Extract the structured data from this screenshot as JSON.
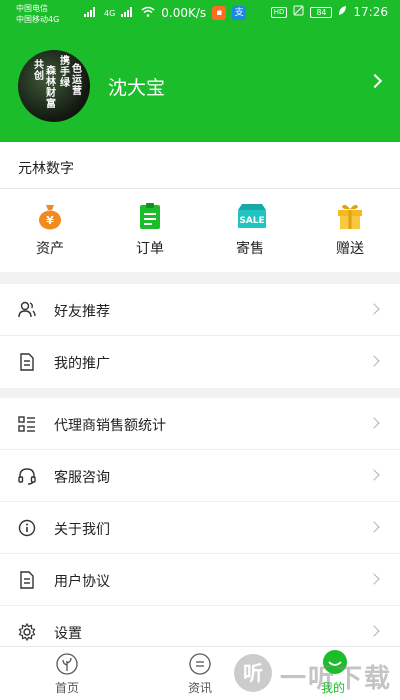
{
  "status_bar": {
    "carrier1": "中国电信",
    "carrier2": "中国移动4G",
    "network_label": "4G",
    "speed": "0.00K/s",
    "battery": "84",
    "time": "17:26",
    "hd": "HD"
  },
  "profile": {
    "name": "沈大宝",
    "avatar_text": [
      "共",
      "创",
      "森",
      "林",
      "财",
      "富",
      "携",
      "手",
      "绿",
      "色",
      "运",
      "营"
    ]
  },
  "wallet": {
    "title": "元林数字",
    "items": [
      {
        "label": "资产",
        "icon": "money-bag-icon",
        "color": "#f28a1e",
        "glyph": "¥"
      },
      {
        "label": "订单",
        "icon": "clipboard-icon",
        "color": "#1bbd2a"
      },
      {
        "label": "寄售",
        "icon": "sale-tag-icon",
        "color": "#20c5c1",
        "glyph": "SALE"
      },
      {
        "label": "赠送",
        "icon": "gift-icon",
        "color": "#f5b81e"
      }
    ]
  },
  "menu": {
    "group1": [
      {
        "label": "好友推荐",
        "icon": "people-icon"
      },
      {
        "label": "我的推广",
        "icon": "document-icon"
      }
    ],
    "group2": [
      {
        "label": "代理商销售额统计",
        "icon": "list-stats-icon"
      },
      {
        "label": "客服咨询",
        "icon": "headset-icon"
      },
      {
        "label": "关于我们",
        "icon": "info-icon"
      },
      {
        "label": "用户协议",
        "icon": "document-icon"
      },
      {
        "label": "设置",
        "icon": "gear-icon"
      }
    ]
  },
  "tabbar": {
    "tabs": [
      {
        "label": "首页",
        "icon": "leaf-icon"
      },
      {
        "label": "资讯",
        "icon": "news-icon"
      },
      {
        "label": "我的",
        "icon": "smile-icon",
        "active": true
      }
    ]
  },
  "watermark": {
    "glyph": "听",
    "text": "一听下载"
  },
  "colors": {
    "brand_green": "#1bbd2a"
  }
}
